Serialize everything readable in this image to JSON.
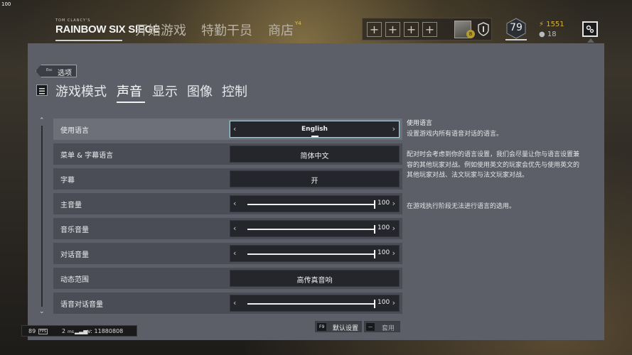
{
  "corner_label": "100",
  "logo": {
    "top_text": "TOM CLANCY'S",
    "main_text": "RAINBOW SIX SIEGE"
  },
  "nav": [
    {
      "label": "开始游戏"
    },
    {
      "label": "特勤干员"
    },
    {
      "label": "商店",
      "badge": "Y4"
    }
  ],
  "squad": {
    "slots": [
      "+",
      "+",
      "+",
      "+"
    ],
    "avatar_badge": "8"
  },
  "player": {
    "level": "79",
    "renown": "1551",
    "credits": "18"
  },
  "settings_icon": "gear-icon",
  "panel": {
    "back": {
      "key": "Esc",
      "label": "选项"
    },
    "tabs": [
      {
        "label": "游戏模式",
        "active": false
      },
      {
        "label": "声音",
        "active": true
      },
      {
        "label": "显示",
        "active": false
      },
      {
        "label": "图像",
        "active": false
      },
      {
        "label": "控制",
        "active": false
      }
    ],
    "rows": [
      {
        "label": "使用语言",
        "type": "selector",
        "value": "English",
        "selected": true
      },
      {
        "label": "菜单 & 字幕语言",
        "type": "value",
        "value": "简体中文"
      },
      {
        "label": "字幕",
        "type": "value",
        "value": "开"
      },
      {
        "label": "主音量",
        "type": "slider",
        "value": "100",
        "level": 1.0
      },
      {
        "label": "音乐音量",
        "type": "slider",
        "value": "100",
        "level": 1.0
      },
      {
        "label": "对话音量",
        "type": "slider",
        "value": "100",
        "level": 1.0
      },
      {
        "label": "动态范围",
        "type": "value",
        "value": "高传真音响"
      },
      {
        "label": "语音对话音量",
        "type": "slider",
        "value": "100",
        "level": 1.0
      }
    ],
    "description": {
      "title": "使用语言",
      "p1": "设置游戏内所有语音对话的语言。",
      "p2": "配对时会考虑到你的语言设置，我们会尽量让你与语言设置兼容的其他玩家对战。例如使用英文的玩家会优先与使用英文的其他玩家对战、法文玩家与法文玩家对战。",
      "p3": "在游戏执行阶段无法进行语言的选用。"
    },
    "footer": {
      "default_key": "F9",
      "default_label": "默认设置",
      "apply_key": "—",
      "apply_label": "套用"
    }
  },
  "statusbar": {
    "fps": "89",
    "fps_icon": "FPS",
    "ping": "2",
    "ping_unit": "ms",
    "version": "v: 11880808"
  }
}
